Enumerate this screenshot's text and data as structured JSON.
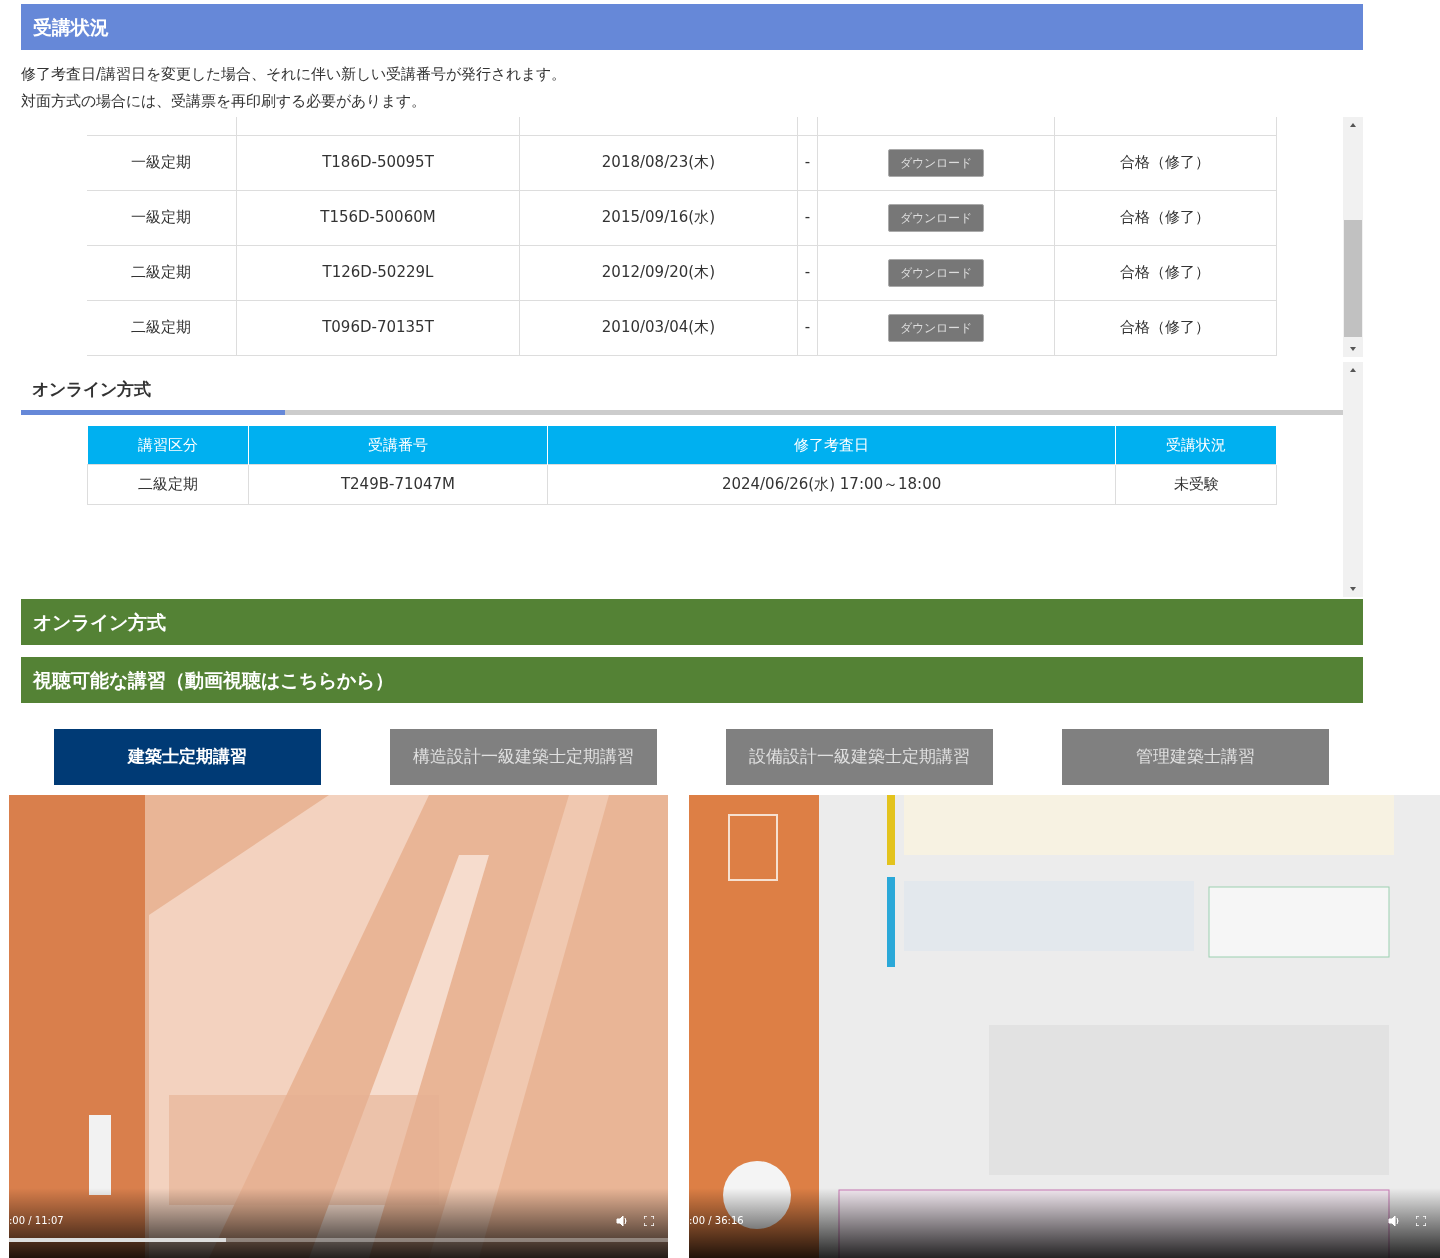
{
  "status_header": {
    "title": "受講状況"
  },
  "notice": [
    "修了考査日/講習日を変更した場合、それに伴い新しい受講番号が発行されます。",
    "対面方式の場合には、受講票を再印刷する必要があります。"
  ],
  "inperson_table": {
    "rows": [
      {
        "course": "一級定期",
        "number": "T186D-50095T",
        "date": "2018/08/23(木)",
        "column_4": "-",
        "download": "ダウンロード",
        "result": "合格（修了）"
      },
      {
        "course": "一級定期",
        "number": "T156D-50060M",
        "date": "2015/09/16(水)",
        "column_4": "-",
        "download": "ダウンロード",
        "result": "合格（修了）"
      },
      {
        "course": "二級定期",
        "number": "T126D-50229L",
        "date": "2012/09/20(木)",
        "column_4": "-",
        "download": "ダウンロード",
        "result": "合格（修了）"
      },
      {
        "course": "二級定期",
        "number": "T096D-70135T",
        "date": "2010/03/04(木)",
        "column_4": "-",
        "download": "ダウンロード",
        "result": "合格（修了）"
      }
    ]
  },
  "online_section": {
    "heading": "オンライン方式",
    "columns": [
      "講習区分",
      "受講番号",
      "修了考査日",
      "受講状況"
    ],
    "rows": [
      {
        "course": "二級定期",
        "number": "T249B-71047M",
        "date": "2024/06/26(水) 17:00～18:00",
        "status": "未受験"
      }
    ]
  },
  "online_bar": "オンライン方式",
  "viewable_bar": "視聴可能な講習（動画視聴はこちらから）",
  "course_tabs": [
    {
      "label": "建築士定期講習",
      "selected": true
    },
    {
      "label": "構造設計一級建築士定期講習",
      "selected": false
    },
    {
      "label": "設備設計一級建築士定期講習",
      "selected": false
    },
    {
      "label": "管理建築士講習",
      "selected": false
    }
  ],
  "videos": [
    {
      "time": ":00 / 11:07",
      "level": 0.33
    },
    {
      "time": ":00 / 36:16"
    }
  ]
}
